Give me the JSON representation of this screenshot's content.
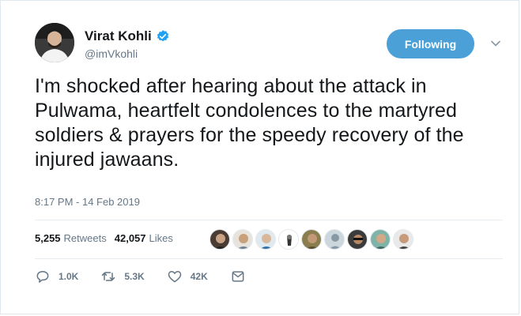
{
  "tweet": {
    "author_name": "Virat Kohli",
    "author_handle": "@imVkohli",
    "follow_label": "Following",
    "text": "I'm shocked after hearing about the attack in Pulwama, heartfelt condolences to the martyred soldiers & prayers for the speedy recovery of the injured jawaans.",
    "timestamp": "8:17 PM - 14 Feb 2019"
  },
  "stats": {
    "retweets_count": "5,255",
    "retweets_label": "Retweets",
    "likes_count": "42,057",
    "likes_label": "Likes"
  },
  "actions": {
    "replies": "1.0K",
    "retweets": "5.3K",
    "likes": "42K"
  },
  "colors": {
    "accent": "#4ba0d8",
    "verified": "#1da1f2",
    "muted": "#657786",
    "text": "#14171a"
  },
  "icons": [
    "verified-badge-icon",
    "chevron-down-icon",
    "reply-icon",
    "retweet-icon",
    "like-icon",
    "direct-message-icon"
  ]
}
